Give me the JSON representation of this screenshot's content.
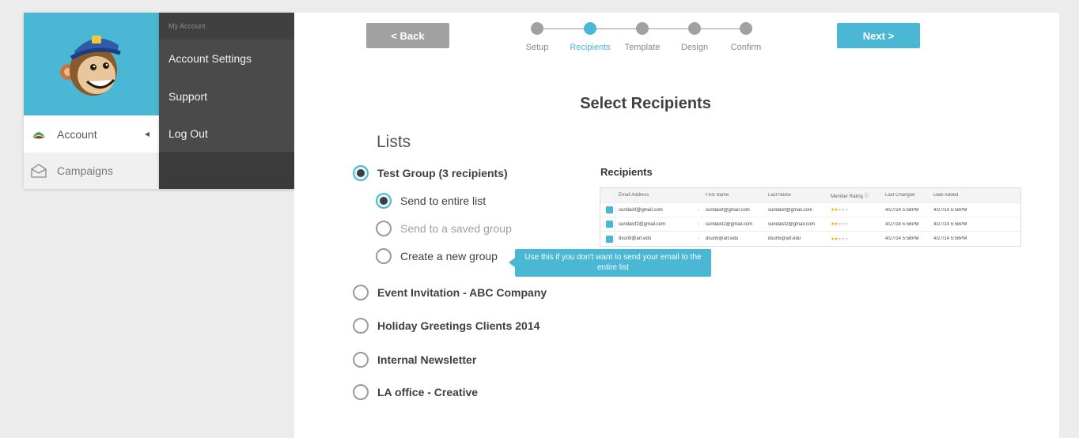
{
  "sidebar": {
    "items": [
      {
        "label": "Account",
        "icon": "mustache-icon"
      },
      {
        "label": "Campaigns",
        "icon": "envelope-icon"
      }
    ]
  },
  "account_menu": {
    "heading": "My Account",
    "items": [
      "Account Settings",
      "Support",
      "Log Out"
    ]
  },
  "wizard": {
    "back_label": "<  Back",
    "next_label": "Next  >",
    "steps": [
      "Setup",
      "Recipients",
      "Template",
      "Design",
      "Confirm"
    ],
    "active_step": "Recipients"
  },
  "page": {
    "title": "Select Recipients",
    "lists_title": "Lists"
  },
  "lists": [
    {
      "label": "Test Group (3 recipients)",
      "selected": true
    },
    {
      "label": "Event Invitation - ABC Company",
      "selected": false
    },
    {
      "label": "Holiday Greetings Clients 2014",
      "selected": false
    },
    {
      "label": "Internal Newsletter",
      "selected": false
    },
    {
      "label": "LA office - Creative",
      "selected": false
    }
  ],
  "sub_options": [
    {
      "label": "Send to entire list",
      "selected": true
    },
    {
      "label": "Send to a saved group",
      "selected": false
    },
    {
      "label": "Create a new group",
      "selected": false
    }
  ],
  "tooltip": "Use this if you don't want to send your email to the entire list",
  "recipients": {
    "title": "Recipients",
    "columns": [
      "Email Address",
      "First Name",
      "Last Name",
      "Member Rating",
      "Last Changed",
      "Date Added"
    ],
    "rows": [
      {
        "email": "sundaisf@gmail.com",
        "first": "sundaisf@gmail.com",
        "last": "sundaisf@gmail.com",
        "rating": 2,
        "changed": "4/27/14 5:58PM",
        "added": "4/27/14 5:58PM"
      },
      {
        "email": "sundaisf2@gmail.com",
        "first": "sundaisf2@gmail.com",
        "last": "sundaisf2@gmail.com",
        "rating": 2,
        "changed": "4/27/14 5:58PM",
        "added": "4/27/14 5:58PM"
      },
      {
        "email": "dsun5@art.edu",
        "first": "dsun5@art.edu",
        "last": "dsun5@art.edu",
        "rating": 2,
        "changed": "4/27/14 5:58PM",
        "added": "4/27/14 5:58PM"
      }
    ]
  },
  "colors": {
    "accent": "#4ab7d5",
    "button_gray": "#a1a1a1",
    "menu_dark": "#4a4a4a"
  }
}
